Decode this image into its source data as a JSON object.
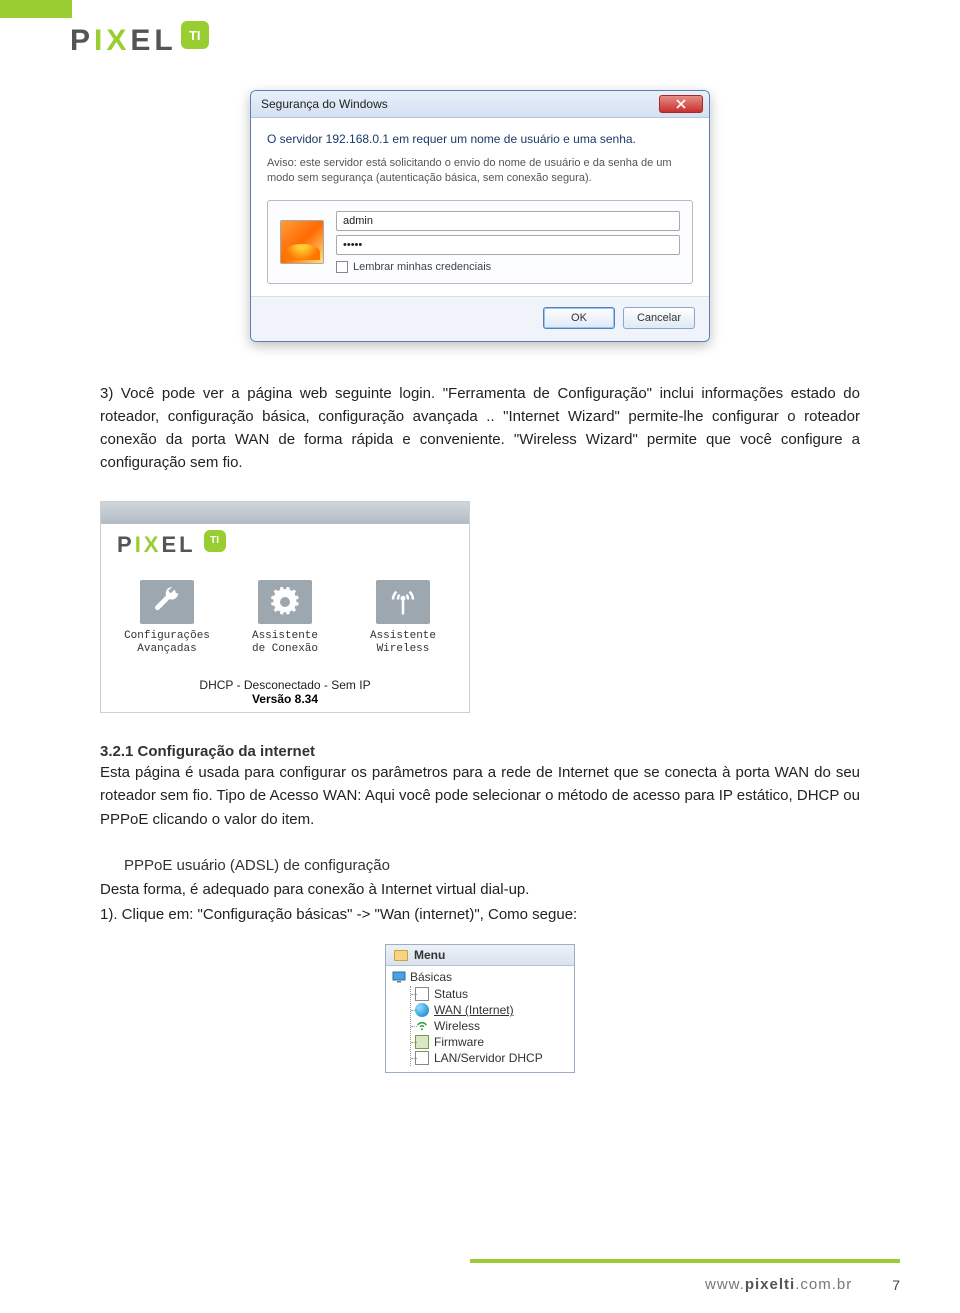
{
  "header": {
    "brand": "PIXEL",
    "ti": "TI"
  },
  "dialog": {
    "title": "Segurança do Windows",
    "message1": "O servidor 192.168.0.1 em  requer um nome de usuário e uma senha.",
    "message2": "Aviso: este servidor está solicitando o envio do nome de usuário e da senha de um modo sem segurança (autenticação básica, sem conexão segura).",
    "username": "admin",
    "password": "•••••",
    "remember": "Lembrar minhas credenciais",
    "ok": "OK",
    "cancel": "Cancelar"
  },
  "para1": "3) Você pode ver a página web seguinte login. \"Ferramenta de Configuração\" inclui informações estado do roteador, configuração básica, configuração avançada .. \"Internet Wizard\" permite-lhe configurar o roteador conexão da porta WAN de forma rápida e conveniente. \"Wireless Wizard\" permite que você configure a configuração sem fio.",
  "router_panel": {
    "icons": [
      {
        "label": "Configurações\nAvançadas"
      },
      {
        "label": "Assistente\nde Conexão"
      },
      {
        "label": "Assistente\nWireless"
      }
    ],
    "status": "DHCP - Desconectado - Sem IP",
    "version": "Versão 8.34"
  },
  "section_head": "3.2.1 Configuração da internet",
  "para2": "Esta página é usada para configurar os parâmetros para a rede de Internet que se conecta à porta WAN do seu roteador sem fio. Tipo de Acesso WAN: Aqui você pode selecionar o método de acesso para IP estático, DHCP ou PPPoE clicando o valor do item.",
  "sub_head": "PPPoE usuário (ADSL) de configuração",
  "para3a": "Desta forma, é adequado para conexão à Internet virtual dial-up.",
  "para3b": "1). Clique em: \"Configuração básicas\" -> \"Wan (internet)\", Como segue:",
  "menu": {
    "title": "Menu",
    "root": "Básicas",
    "items": [
      "Status",
      "WAN (Internet)",
      "Wireless",
      "Firmware",
      "LAN/Servidor DHCP"
    ]
  },
  "footer": {
    "url_prefix": "www.",
    "url_bold": "pixelti",
    "url_suffix": ".com.br",
    "page": "7"
  }
}
